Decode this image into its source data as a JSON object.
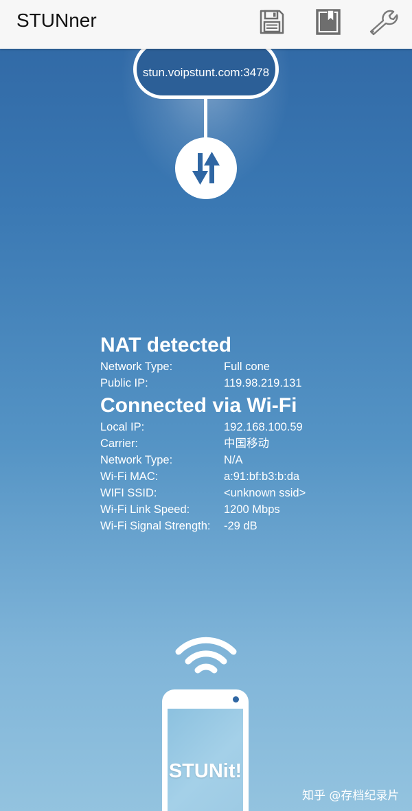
{
  "app": {
    "title": "STUNner"
  },
  "toolbar": {
    "actions": [
      {
        "icon": "floppy-disk-icon"
      },
      {
        "icon": "bookmark-icon"
      },
      {
        "icon": "wrench-icon"
      }
    ]
  },
  "server": {
    "address": "stun.voipstunt.com:3478"
  },
  "nat": {
    "heading": "NAT detected",
    "rows": [
      {
        "label": "Network Type:",
        "value": "Full cone"
      },
      {
        "label": "Public IP:",
        "value": "119.98.219.131"
      }
    ]
  },
  "connection": {
    "heading": "Connected via Wi-Fi",
    "rows": [
      {
        "label": "Local IP:",
        "value": "192.168.100.59"
      },
      {
        "label": "Carrier:",
        "value": "中国移动"
      },
      {
        "label": "Network Type:",
        "value": "N/A"
      },
      {
        "label": "Wi-Fi MAC:",
        "value": "a:91:bf:b3:b:da"
      },
      {
        "label": "WIFI SSID:",
        "value": "<unknown ssid>"
      },
      {
        "label": "Wi-Fi Link Speed:",
        "value": "1200 Mbps"
      },
      {
        "label": "Wi-Fi Signal Strength:",
        "value": "-29 dB"
      }
    ]
  },
  "action": {
    "label": "STUNit!"
  },
  "watermark": {
    "text": "知乎 @存档纪录片"
  },
  "colors": {
    "accent": "#2f66a3",
    "toolbar_bg": "#f7f7f7",
    "text_on_bg": "#ffffff"
  }
}
